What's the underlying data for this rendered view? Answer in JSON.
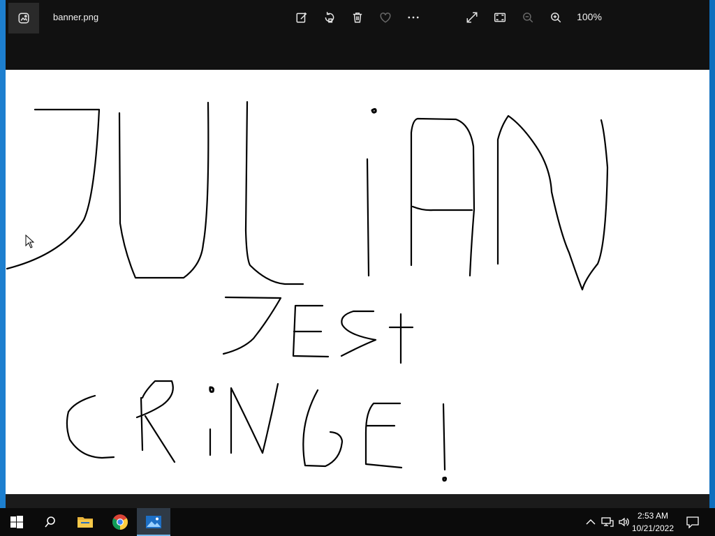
{
  "window": {
    "file_name": "banner.png",
    "zoom_level": "100%"
  },
  "toolbar": [
    {
      "name": "edit-create-icon",
      "enabled": true
    },
    {
      "name": "rotate-icon",
      "enabled": true
    },
    {
      "name": "delete-icon",
      "enabled": true
    },
    {
      "name": "favorite-icon",
      "enabled": true
    },
    {
      "name": "more-options-icon",
      "enabled": true
    },
    {
      "name": "expand-icon",
      "enabled": true
    },
    {
      "name": "fit-to-window-icon",
      "enabled": true
    },
    {
      "name": "zoom-out-icon",
      "enabled": false
    },
    {
      "name": "zoom-in-icon",
      "enabled": true
    }
  ],
  "image": {
    "handwritten_text": [
      "JULIAN",
      "JEST",
      "CRINGE!"
    ]
  },
  "taskbar": {
    "apps": [
      "start-icon",
      "search-icon",
      "file-explorer-icon",
      "chrome-icon",
      "photos-icon"
    ],
    "active_app": "photos-icon",
    "tray": [
      "show-hidden-icons-icon",
      "network-icon",
      "volume-icon",
      "notifications-icon"
    ],
    "time": "2:53 AM",
    "date": "10/21/2022"
  },
  "colors": {
    "titlebar": "#111111",
    "canvas": "#ffffff",
    "ink": "#000000",
    "taskbar": "#0b0b0b",
    "desktop": "#0e6fbe",
    "active_indicator": "#76b9ed"
  }
}
